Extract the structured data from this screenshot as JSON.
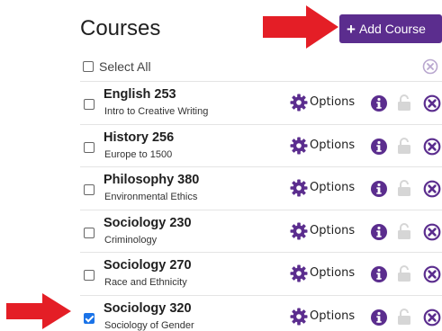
{
  "header": {
    "title": "Courses",
    "add_label": "Add Course",
    "add_icon": "plus-icon"
  },
  "select_all": {
    "label": "Select All",
    "checked": false
  },
  "courses": [
    {
      "name": "English 253",
      "description": "Intro to Creative Writing",
      "checked": false,
      "options_label": "Options"
    },
    {
      "name": "History 256",
      "description": "Europe to 1500",
      "checked": false,
      "options_label": "Options"
    },
    {
      "name": "Philosophy 380",
      "description": "Environmental Ethics",
      "checked": false,
      "options_label": "Options"
    },
    {
      "name": "Sociology 230",
      "description": "Criminology",
      "checked": false,
      "options_label": "Options"
    },
    {
      "name": "Sociology 270",
      "description": "Race and Ethnicity",
      "checked": false,
      "options_label": "Options"
    },
    {
      "name": "Sociology 320",
      "description": "Sociology of Gender",
      "checked": true,
      "options_label": "Options"
    }
  ],
  "colors": {
    "brand_purple": "#5b2d8e",
    "annotation_red": "#e41e26",
    "checkbox_blue": "#1a73e8",
    "lock_gray": "#d6d6d6"
  },
  "icons": [
    "gear-icon",
    "info-icon",
    "lock-icon",
    "remove-icon",
    "arrow-annotation"
  ]
}
